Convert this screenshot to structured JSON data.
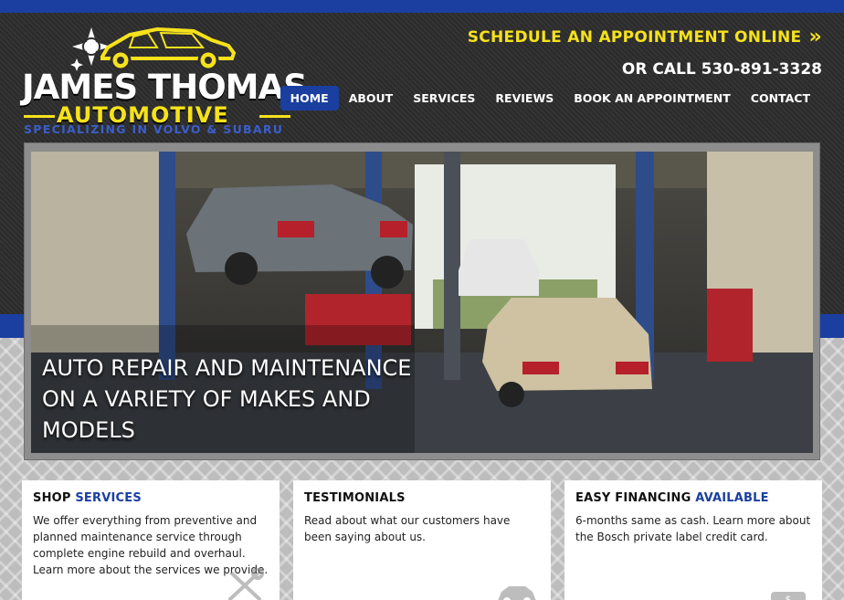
{
  "logo": {
    "name": "JAMES THOMAS",
    "subtitle": "AUTOMOTIVE",
    "tagline": "SPECIALIZING IN VOLVO & SUBARU"
  },
  "header": {
    "cta_label": "SCHEDULE AN APPOINTMENT ONLINE",
    "phone_text": "OR CALL 530-891-3328"
  },
  "nav": {
    "items": [
      {
        "label": "HOME",
        "active": true
      },
      {
        "label": "ABOUT"
      },
      {
        "label": "SERVICES"
      },
      {
        "label": "REVIEWS"
      },
      {
        "label": "BOOK AN APPOINTMENT"
      },
      {
        "label": "CONTACT"
      }
    ]
  },
  "hero": {
    "headline": "AUTO REPAIR AND MAINTENANCE ON A VARIETY OF MAKES AND MODELS"
  },
  "cards": [
    {
      "title_plain": "SHOP",
      "title_accent": "SERVICES",
      "body": "We offer everything from preventive and planned maintenance service through complete engine rebuild and overhaul. Learn more about the services we provide.",
      "icon": "wrench-screwdriver-icon"
    },
    {
      "title_plain": "TESTIMONIALS",
      "title_accent": "",
      "body": "Read about what our customers have been saying about us.",
      "icon": "car-icon"
    },
    {
      "title_plain": "EASY FINANCING",
      "title_accent": "AVAILABLE",
      "body": "6-months same as cash. Learn more about the Bosch private label credit card.",
      "icon": "money-icon"
    }
  ],
  "colors": {
    "accent_blue": "#1a3fa0",
    "accent_yellow": "#f6e21b",
    "header_bg": "#2d2d2d"
  }
}
